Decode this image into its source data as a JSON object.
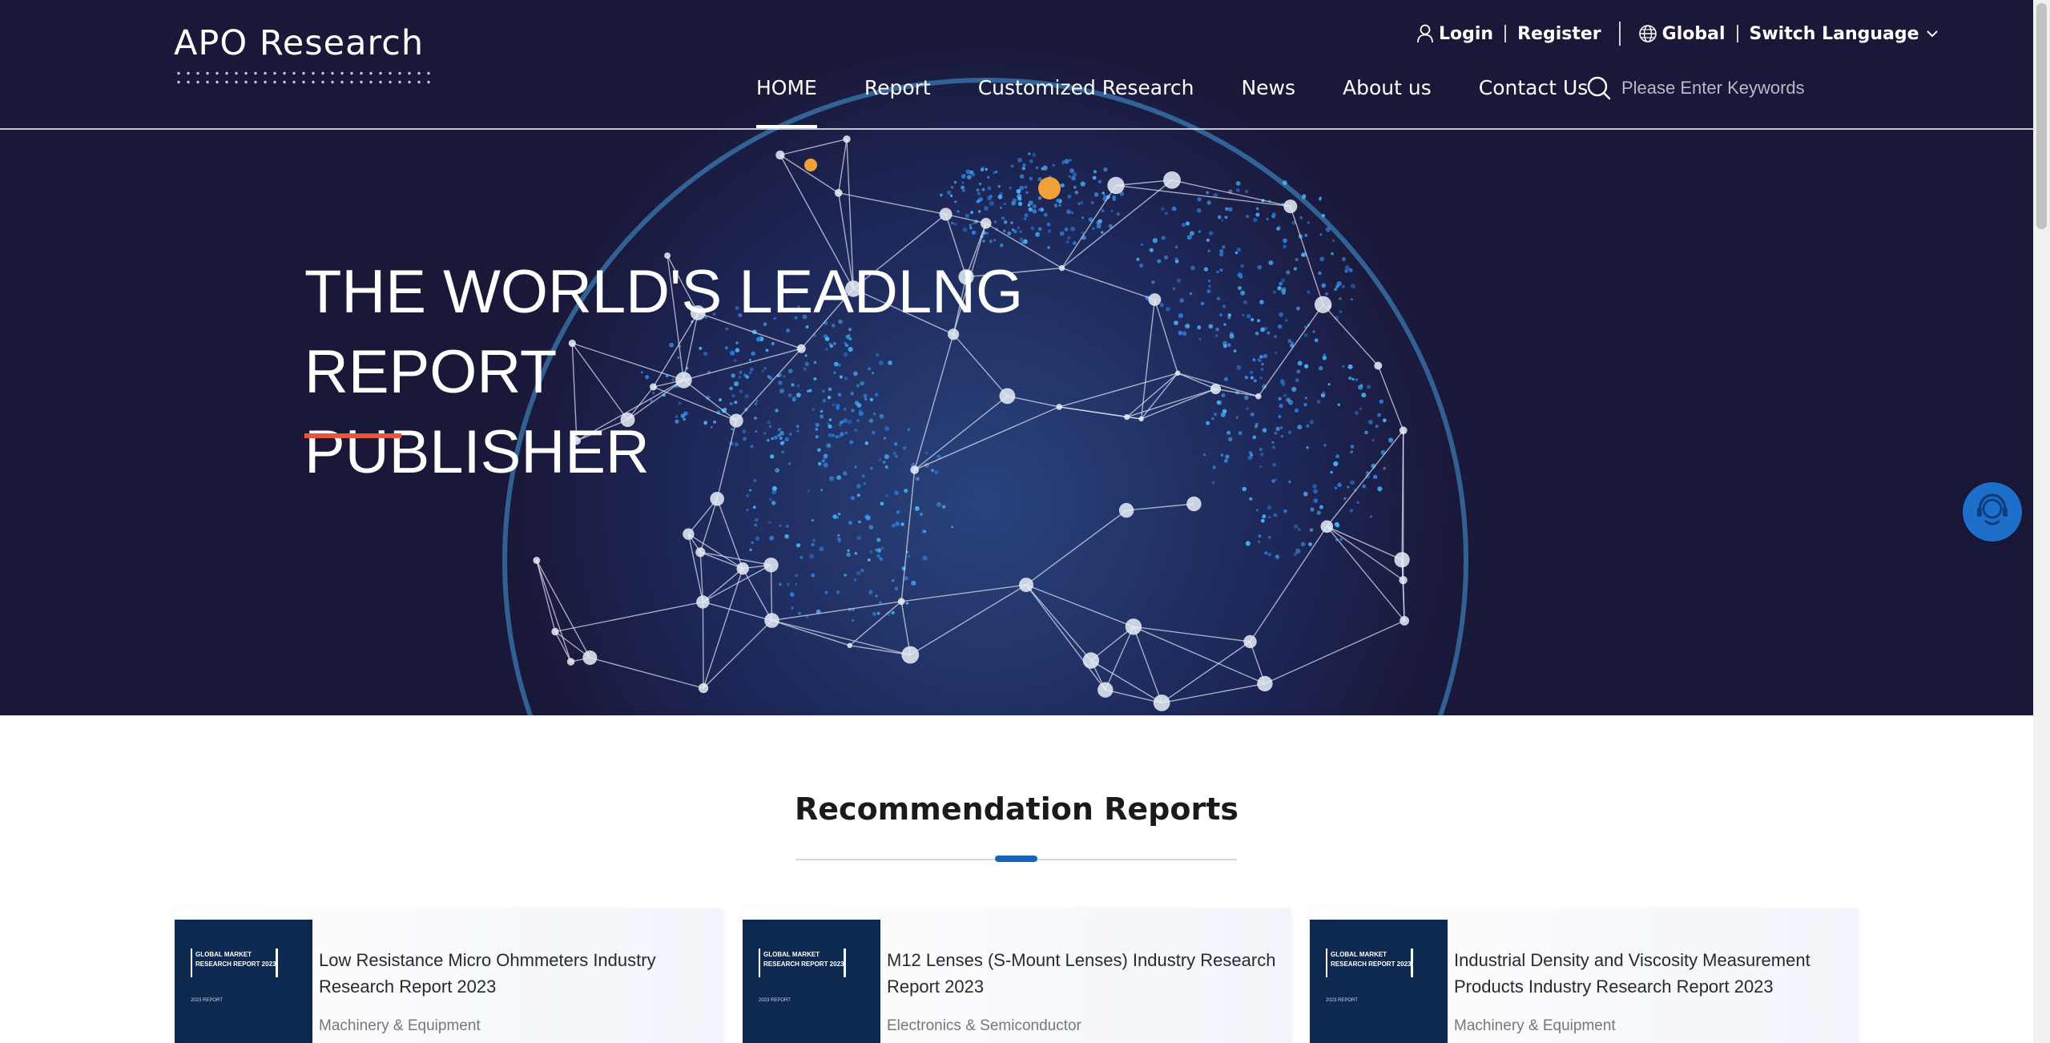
{
  "header": {
    "logo_text": "APO Research",
    "login_label": "Login",
    "register_label": "Register",
    "region_label": "Global",
    "language_label": "Switch Language"
  },
  "nav": {
    "items": [
      {
        "label": "HOME",
        "active": true
      },
      {
        "label": "Report",
        "active": false
      },
      {
        "label": "Customized Research",
        "active": false
      },
      {
        "label": "News",
        "active": false
      },
      {
        "label": "About us",
        "active": false
      },
      {
        "label": "Contact Us",
        "active": false
      }
    ]
  },
  "search": {
    "placeholder": "Please Enter Keywords",
    "value": ""
  },
  "hero": {
    "title_line1": "THE WORLD'S LEADLNG REPORT",
    "title_line2": "PUBLISHER",
    "accent_color": "#e8553e",
    "background_color": "#1a1838"
  },
  "recommendations": {
    "heading": "Recommendation Reports",
    "accent_color": "#1763b9",
    "cards": [
      {
        "cover_text_line1": "GLOBAL MARKET",
        "cover_text_line2": "RESEARCH REPORT 2023",
        "cover_sub": "2023 REPORT",
        "title": "Low Resistance Micro Ohmmeters Industry Research Report 2023",
        "category": "Machinery & Equipment"
      },
      {
        "cover_text_line1": "GLOBAL MARKET",
        "cover_text_line2": "RESEARCH REPORT 2023",
        "cover_sub": "2023 REPORT",
        "title": "M12 Lenses (S-Mount Lenses) Industry Research Report 2023",
        "category": "Electronics & Semiconductor"
      },
      {
        "cover_text_line1": "GLOBAL MARKET",
        "cover_text_line2": "RESEARCH REPORT 2023",
        "cover_sub": "2023 REPORT",
        "title": "Industrial Density and Viscosity Measurement Products Industry Research Report 2023",
        "category": "Machinery & Equipment"
      }
    ]
  },
  "icons": {
    "user": "user-icon",
    "globe": "globe-icon",
    "chevron": "chevron-down-icon",
    "search": "search-icon",
    "chat": "customer-service-icon"
  }
}
